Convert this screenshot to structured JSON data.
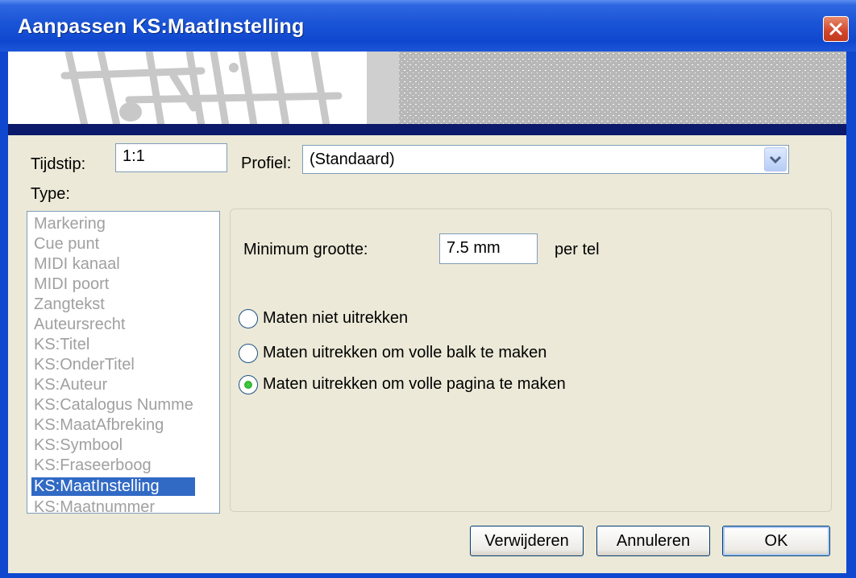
{
  "window": {
    "title": "Aanpassen KS:MaatInstelling"
  },
  "form": {
    "tijdstip_label": "Tijdstip:",
    "tijdstip_value": "1:1",
    "profiel_label": "Profiel:",
    "profiel_value": "(Standaard)",
    "type_label": "Type:"
  },
  "type_list": {
    "items": [
      "Markering",
      "Cue punt",
      "MIDI kanaal",
      "MIDI poort",
      "Zangtekst",
      "Auteursrecht",
      "KS:Titel",
      "KS:OnderTitel",
      "KS:Auteur",
      "KS:Catalogus Numme",
      "KS:MaatAfbreking",
      "KS:Symbool",
      "KS:Fraseerboog",
      "KS:MaatInstelling",
      "KS:Maatnummer"
    ],
    "selected": "KS:MaatInstelling"
  },
  "settings": {
    "min_size_label": "Minimum grootte:",
    "min_size_value": "7.5 mm",
    "min_size_unit": "per tel",
    "options": [
      "Maten niet uitrekken",
      "Maten uitrekken om volle balk te maken",
      "Maten uitrekken om volle pagina te maken"
    ],
    "selected_option": "Maten uitrekken om volle pagina te maken"
  },
  "buttons": {
    "delete": "Verwijderen",
    "cancel": "Annuleren",
    "ok": "OK"
  },
  "colors": {
    "titlebar": "#0f48cf",
    "selection": "#316ac5",
    "dialog_bg": "#ece9d8",
    "radio_dot": "#21a121"
  },
  "icons": {
    "close": "close-icon",
    "dropdown": "chevron-down-icon",
    "scroll_up": "arrow-up-icon",
    "scroll_down": "arrow-down-icon"
  }
}
